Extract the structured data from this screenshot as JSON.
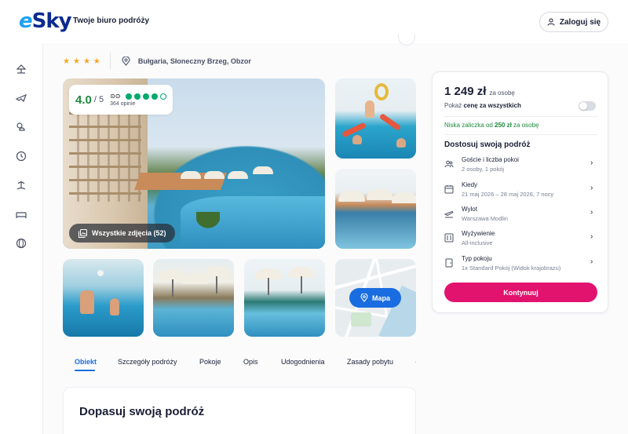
{
  "header": {
    "logo": "eSky",
    "tagline": "Twoje biuro podróży",
    "login_label": "Zaloguj się"
  },
  "sidebar": {
    "items": [
      {
        "icon": "beach-icon"
      },
      {
        "icon": "plane-icon"
      },
      {
        "icon": "sun-cloud-icon"
      },
      {
        "icon": "clock-icon"
      },
      {
        "icon": "island-icon"
      },
      {
        "icon": "bed-icon"
      },
      {
        "icon": "globe-icon"
      }
    ]
  },
  "hotel": {
    "stars": 4,
    "star_glyph": "★",
    "location": "Bułgaria, Słoneczny Brzeg, Obzor"
  },
  "rating": {
    "score": "4.0",
    "scale": "/ 5",
    "reviews": "364 opinie",
    "dots_filled": 4,
    "dots_total": 5
  },
  "gallery": {
    "all_photos_label": "Wszystkie zdjęcia (52)",
    "map_label": "Mapa"
  },
  "tabs": [
    {
      "label": "Obiekt",
      "active": true
    },
    {
      "label": "Szczegóły podróży",
      "active": false
    },
    {
      "label": "Pokoje",
      "active": false
    },
    {
      "label": "Opis",
      "active": false
    },
    {
      "label": "Udogodnienia",
      "active": false
    },
    {
      "label": "Zasady pobytu",
      "active": false
    }
  ],
  "adjust_section": {
    "title": "Dopasuj swoją podróż"
  },
  "booking": {
    "price": "1 249 zł",
    "price_unit": "za osobę",
    "toggle_prefix": "Pokaż ",
    "toggle_bold": "cenę za wszystkich",
    "deposit_prefix": "Niska zaliczka od ",
    "deposit_amount": "250 zł",
    "deposit_suffix": " za osobę",
    "adjust_heading": "Dostosuj swoją podróż",
    "options": [
      {
        "icon": "guests-icon",
        "label": "Goście i liczba pokoi",
        "value": "2 osoby, 1 pokój"
      },
      {
        "icon": "calendar-icon",
        "label": "Kiedy",
        "value": "21 maj 2026 – 28 maj 2026, 7 nocy"
      },
      {
        "icon": "departure-icon",
        "label": "Wylot",
        "value": "Warszawa Modlin"
      },
      {
        "icon": "meal-icon",
        "label": "Wyżywienie",
        "value": "All-inclusive"
      },
      {
        "icon": "room-icon",
        "label": "Typ pokoju",
        "value": "1x Standard Pokój (Widok krajobrazu)"
      }
    ],
    "continue_label": "Kontynuuj"
  },
  "colors": {
    "brand_blue": "#0a2a8f",
    "accent_blue": "#1a6de0",
    "cta_pink": "#e2136e",
    "rating_green": "#1d8a3b",
    "tripadvisor_green": "#00aa6c",
    "star_orange": "#f5a623"
  }
}
